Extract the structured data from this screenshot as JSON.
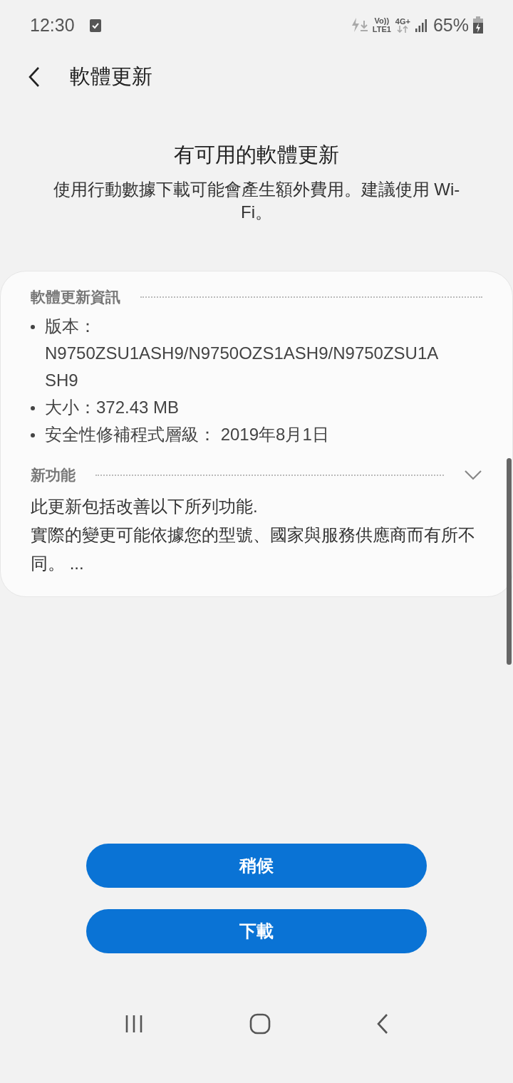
{
  "status_bar": {
    "time": "12:30",
    "volte": "Vo))",
    "lte": "LTE1",
    "network": "4G+",
    "battery": "65%"
  },
  "header": {
    "title": "軟體更新"
  },
  "intro": {
    "title": "有可用的軟體更新",
    "message": "使用行動數據下載可能會產生額外費用。建議使用 Wi-Fi。"
  },
  "info": {
    "heading": "軟體更新資訊",
    "items": [
      "版本：N9750ZSU1ASH9/N9750OZS1ASH9/N9750ZSU1ASH9",
      "大小：372.43 MB",
      "安全性修補程式層級： 2019年8月1日"
    ]
  },
  "whats_new": {
    "heading": "新功能",
    "expanded": false,
    "paragraphs": [
      "此更新包括改善以下所列功能.",
      "實際的變更可能依據您的型號、國家與服務供應商而有所不同。 ..."
    ]
  },
  "buttons": [
    "稍候",
    "下載"
  ]
}
